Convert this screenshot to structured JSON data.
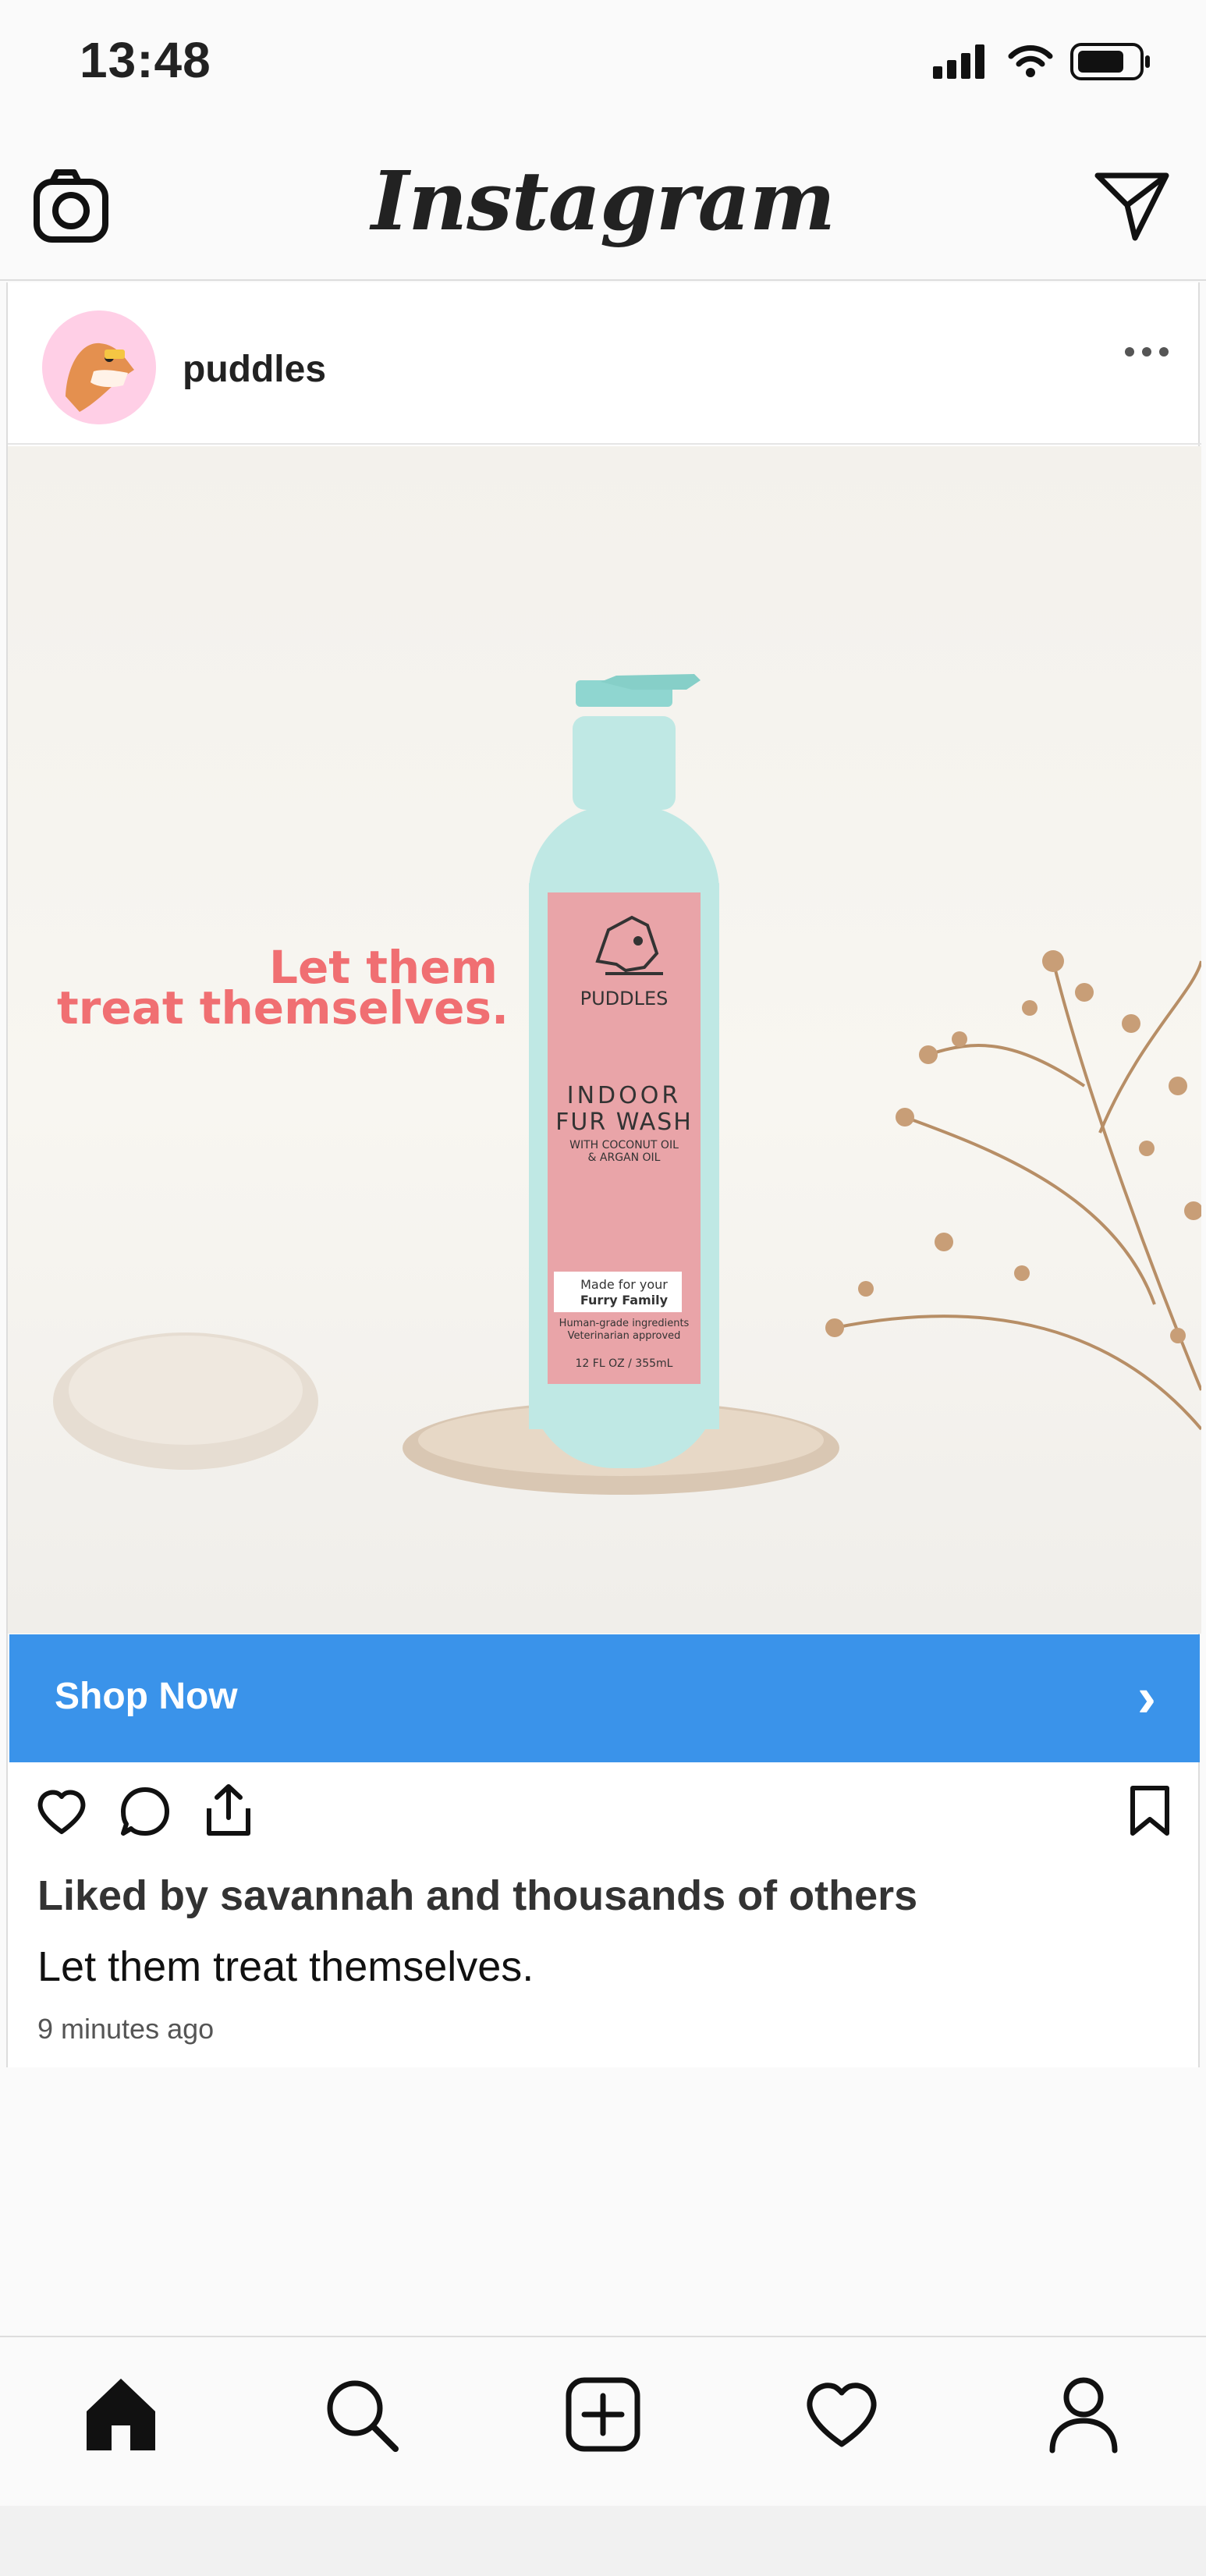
{
  "status_bar": {
    "time": "13:48",
    "icons": [
      "signal-icon",
      "wifi-icon",
      "battery-icon"
    ]
  },
  "top_bar": {
    "title": "Instagram",
    "left_icon": "camera-icon",
    "right_icon": "send-icon"
  },
  "post": {
    "username": "puddles",
    "more_icon": "more-icon",
    "image": {
      "headline_line1": "Let them",
      "headline_line2": "treat themselves.",
      "brand": "PUDDLES",
      "product_line1": "INDOOR",
      "product_line2": "FUR WASH",
      "product_sub1": "WITH COCONUT OIL",
      "product_sub2": "& ARGAN OIL",
      "made_for1": "Made for your",
      "made_for2": "Furry Family",
      "ingredients1": "Human-grade ingredients",
      "ingredients2": "Veterinarian approved",
      "volume": "12 FL OZ / 355mL"
    },
    "cta": {
      "label": "Shop Now",
      "chevron": "›"
    },
    "actions": [
      "heart-icon",
      "comment-icon",
      "share-icon",
      "bookmark-icon"
    ],
    "liked_by": "Liked by savannah and thousands of others",
    "caption": "Let them treat themselves.",
    "time_ago": "9 minutes ago"
  },
  "bottom_nav": {
    "items": [
      "home-icon",
      "search-icon",
      "add-icon",
      "heart-icon",
      "profile-icon"
    ]
  },
  "colors": {
    "cta": "#3a93ea",
    "headline": "#f06f72",
    "bottle": "#bfe8e4",
    "label": "#e8a0a4"
  }
}
